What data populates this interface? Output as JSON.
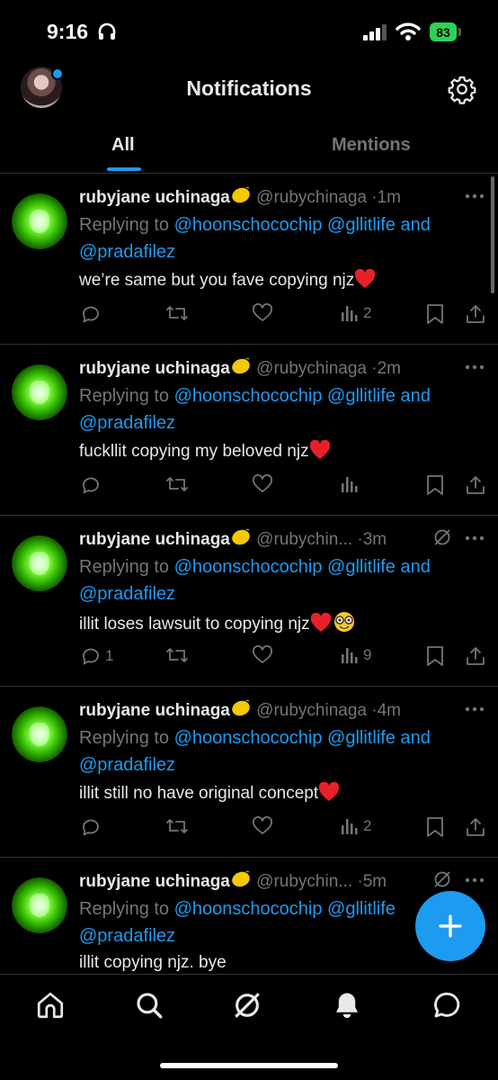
{
  "status_bar": {
    "time": "9:16",
    "battery": "83"
  },
  "header": {
    "title": "Notifications"
  },
  "tabs": [
    {
      "label": "All"
    },
    {
      "label": "Mentions"
    }
  ],
  "tweets": [
    {
      "name": "rubyjane uchinaga",
      "handle": "@rubychinaga",
      "time": "1m",
      "replying_prefix": "Replying to",
      "mention1": "@hoonschocochip",
      "mention2": "@gllitlife",
      "and": "and",
      "mention3": "@pradafilez",
      "text": "we’re same but you fave copying njz",
      "reply_count": "",
      "views": "2"
    },
    {
      "name": "rubyjane uchinaga",
      "handle": "@rubychinaga",
      "time": "2m",
      "replying_prefix": "Replying to",
      "mention1": "@hoonschocochip",
      "mention2": "@gllitlife",
      "and": "and",
      "mention3": "@pradafilez",
      "text": "fuckllit  copying my beloved njz",
      "reply_count": "",
      "views": ""
    },
    {
      "name": "rubyjane uchinaga",
      "handle": "@rubychin...",
      "time": "3m",
      "replying_prefix": "Replying to",
      "mention1": "@hoonschocochip",
      "mention2": "@gllitlife",
      "and": "and",
      "mention3": "@pradafilez",
      "text": "illit loses lawsuit to copying njz",
      "reply_count": "1",
      "views": "9"
    },
    {
      "name": "rubyjane uchinaga",
      "handle": "@rubychinaga",
      "time": "4m",
      "replying_prefix": "Replying to",
      "mention1": "@hoonschocochip",
      "mention2": "@gllitlife",
      "and": "and",
      "mention3": "@pradafilez",
      "text": "illit still no have original concept",
      "reply_count": "",
      "views": "2"
    },
    {
      "name": "rubyjane uchinaga",
      "handle": "@rubychin...",
      "time": "5m",
      "replying_prefix": "Replying to",
      "mention1": "@hoonschocochip",
      "mention2": "@gllitlife",
      "and": "",
      "mention3": "@pradafilez",
      "text": "illit copying njz. bye",
      "reply_count": "",
      "views": ""
    }
  ],
  "icons": {
    "settings": "gear-icon",
    "reply": "reply-icon",
    "retweet": "retweet-icon",
    "like": "heart-icon",
    "views": "views-icon",
    "bookmark": "bookmark-icon",
    "share": "share-icon",
    "compose": "plus-icon",
    "home": "home-icon",
    "search": "search-icon",
    "grok": "grok-icon",
    "notifications": "bell-icon",
    "messages": "message-icon"
  },
  "colors": {
    "accent": "#1d9bf0",
    "muted": "#71767b",
    "background": "#000000",
    "battery": "#30d158"
  }
}
